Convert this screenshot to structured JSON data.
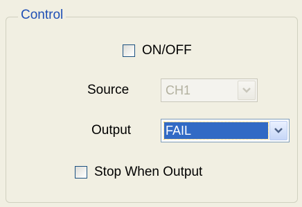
{
  "group": {
    "title": "Control"
  },
  "onoff": {
    "label": "ON/OFF",
    "checked": false
  },
  "source": {
    "label": "Source",
    "value": "CH1",
    "enabled": false
  },
  "output": {
    "label": "Output",
    "value": "FAIL",
    "enabled": true
  },
  "stop_when_output": {
    "label": "Stop When Output",
    "checked": false
  },
  "icons": {
    "dropdown": "chevron-down-icon"
  },
  "colors": {
    "title": "#1f4fb5",
    "selection": "#316ac5",
    "background": "#f1efe2"
  }
}
